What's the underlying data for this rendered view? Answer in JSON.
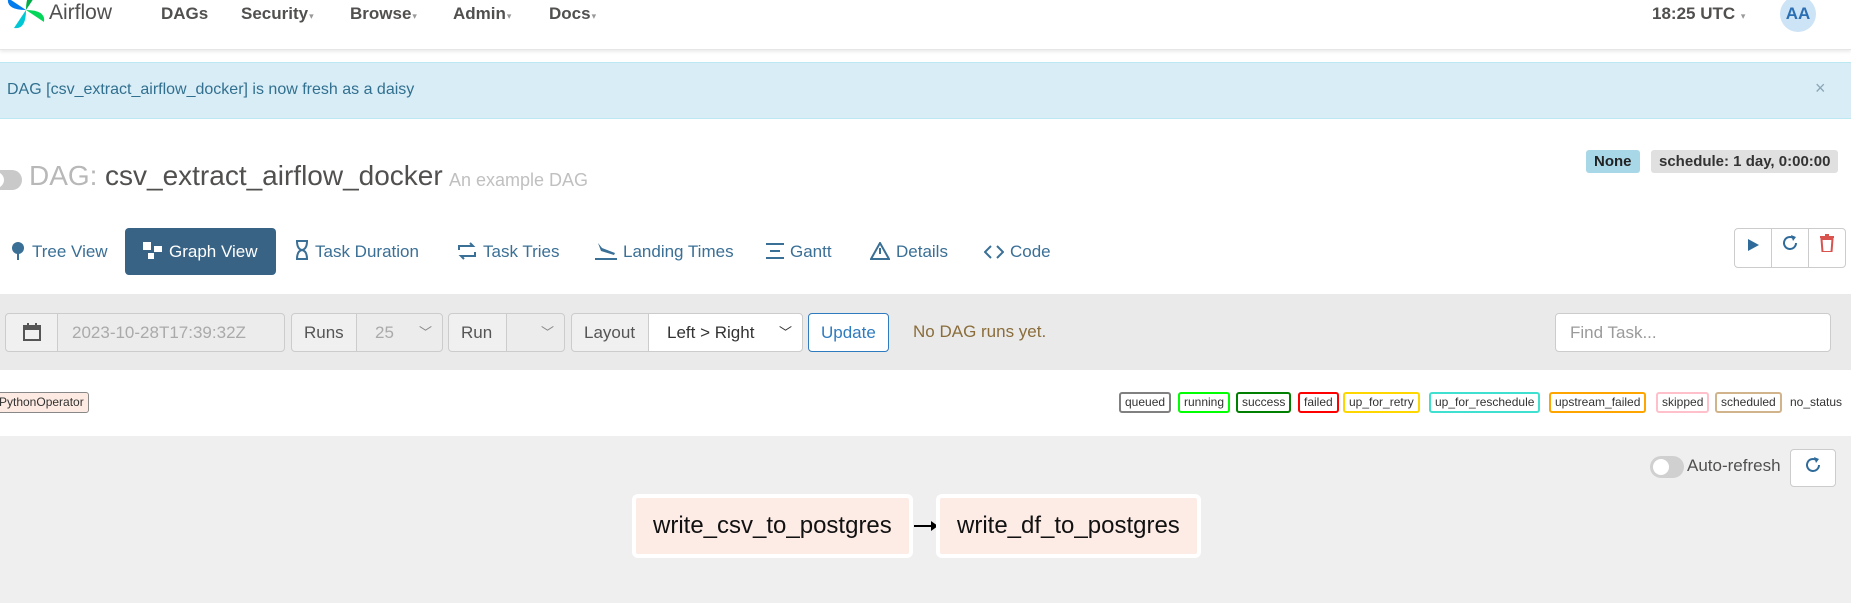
{
  "nav": {
    "brand": "Airflow",
    "items": [
      "DAGs",
      "Security",
      "Browse",
      "Admin",
      "Docs"
    ],
    "clock": "18:25 UTC",
    "avatar": "AA"
  },
  "alert": {
    "message": "DAG [csv_extract_airflow_docker] is now fresh as a daisy",
    "close": "×"
  },
  "dag": {
    "prefix": "DAG:",
    "name": "csv_extract_airflow_docker",
    "description": "An example DAG",
    "label_none": "None",
    "schedule": "schedule: 1 day, 0:00:00"
  },
  "tabs": [
    {
      "label": "Tree View",
      "icon": "tree-icon"
    },
    {
      "label": "Graph View",
      "icon": "graph-icon",
      "active": true
    },
    {
      "label": "Task Duration",
      "icon": "hourglass-icon"
    },
    {
      "label": "Task Tries",
      "icon": "retry-icon"
    },
    {
      "label": "Landing Times",
      "icon": "plane-landing-icon"
    },
    {
      "label": "Gantt",
      "icon": "gantt-icon"
    },
    {
      "label": "Details",
      "icon": "warning-triangle-icon"
    },
    {
      "label": "Code",
      "icon": "code-icon"
    }
  ],
  "actions": [
    "play-icon",
    "refresh-icon",
    "trash-icon"
  ],
  "controls": {
    "date_value": "2023-10-28T17:39:32Z",
    "runs_label": "Runs",
    "runs_value": "25",
    "run_label": "Run",
    "run_value": "",
    "layout_label": "Layout",
    "layout_value": "Left > Right",
    "update": "Update",
    "no_runs": "No DAG runs yet.",
    "find_placeholder": "Find Task..."
  },
  "legend": {
    "operator": "PythonOperator",
    "states": [
      {
        "label": "queued",
        "color": "#808080"
      },
      {
        "label": "running",
        "color": "#00ff00"
      },
      {
        "label": "success",
        "color": "#008000"
      },
      {
        "label": "failed",
        "color": "#ff0000"
      },
      {
        "label": "up_for_retry",
        "color": "#ffd700"
      },
      {
        "label": "up_for_reschedule",
        "color": "#40e0d0"
      },
      {
        "label": "upstream_failed",
        "color": "#ffa500"
      },
      {
        "label": "skipped",
        "color": "#ffc0cb"
      },
      {
        "label": "scheduled",
        "color": "#d2b48c"
      }
    ],
    "no_status": "no_status"
  },
  "graph": {
    "auto_refresh": "Auto-refresh",
    "nodes": [
      "write_csv_to_postgres",
      "write_df_to_postgres"
    ]
  }
}
